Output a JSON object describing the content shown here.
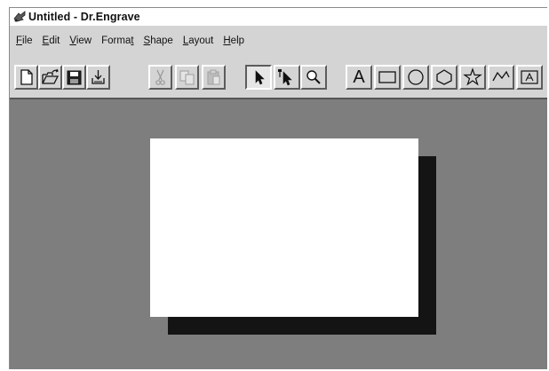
{
  "window": {
    "title": "Untitled - Dr.Engrave",
    "icon": "app-engraver-icon"
  },
  "menubar": {
    "items": [
      {
        "label": "File",
        "accel": "F",
        "rest": "ile"
      },
      {
        "label": "Edit",
        "accel": "E",
        "rest": "dit"
      },
      {
        "label": "View",
        "accel": "V",
        "rest": "iew"
      },
      {
        "label": "Format",
        "pre": "Forma",
        "accel": "t",
        "rest": ""
      },
      {
        "label": "Shape",
        "accel": "S",
        "rest": "hape"
      },
      {
        "label": "Layout",
        "accel": "L",
        "rest": "ayout"
      },
      {
        "label": "Help",
        "accel": "H",
        "rest": "elp"
      }
    ]
  },
  "toolbar": {
    "buttons": [
      {
        "name": "new-document",
        "icon": "new-document-icon",
        "enabled": true
      },
      {
        "name": "open",
        "icon": "open-folder-icon",
        "enabled": true
      },
      {
        "name": "save",
        "icon": "save-disk-icon",
        "enabled": true
      },
      {
        "name": "print",
        "icon": "print-output-icon",
        "enabled": true
      },
      {
        "name": "cut",
        "icon": "scissors-icon",
        "enabled": false
      },
      {
        "name": "copy",
        "icon": "copy-icon",
        "enabled": false
      },
      {
        "name": "paste",
        "icon": "paste-clipboard-icon",
        "enabled": false
      },
      {
        "name": "select",
        "icon": "arrow-pointer-icon",
        "enabled": true,
        "pressed": true
      },
      {
        "name": "node-edit",
        "icon": "node-edit-pointer-icon",
        "enabled": true
      },
      {
        "name": "zoom",
        "icon": "magnifier-icon",
        "enabled": true
      },
      {
        "name": "text",
        "icon": "text-tool-icon",
        "label": "A",
        "enabled": true
      },
      {
        "name": "rectangle",
        "icon": "rectangle-icon",
        "enabled": true
      },
      {
        "name": "circle",
        "icon": "circle-icon",
        "enabled": true
      },
      {
        "name": "polygon",
        "icon": "polygon-icon",
        "enabled": true
      },
      {
        "name": "star",
        "icon": "star-icon",
        "enabled": true
      },
      {
        "name": "polyline",
        "icon": "polyline-icon",
        "enabled": true
      },
      {
        "name": "text-frame",
        "icon": "text-frame-icon",
        "enabled": true
      }
    ]
  },
  "colors": {
    "workspace": "#7e7e7e",
    "page": "#ffffff",
    "page_shadow": "#141414",
    "chrome": "#d4d4d4"
  }
}
